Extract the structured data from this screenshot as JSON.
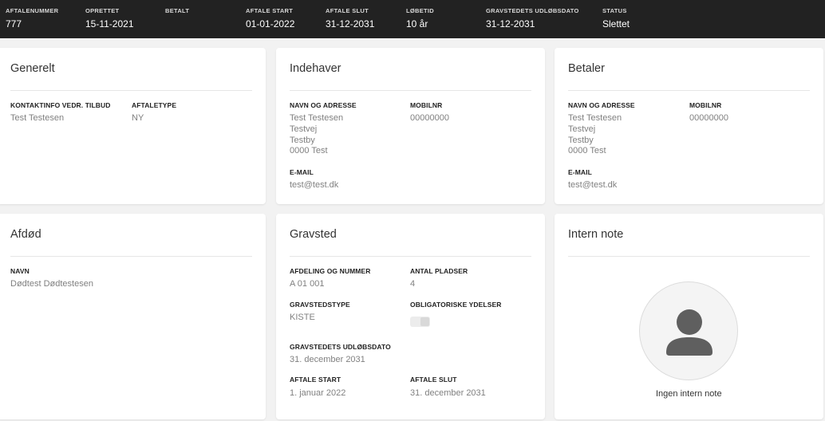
{
  "header": {
    "fields": [
      {
        "label": "AFTALENUMMER",
        "value": "777"
      },
      {
        "label": "OPRETTET",
        "value": "15-11-2021"
      },
      {
        "label": "BETALT",
        "value": ""
      },
      {
        "label": "AFTALE START",
        "value": "01-01-2022"
      },
      {
        "label": "AFTALE SLUT",
        "value": "31-12-2031"
      },
      {
        "label": "LØBETID",
        "value": "10 år"
      },
      {
        "label": "GRAVSTEDETS UDLØBSDATO",
        "value": "31-12-2031"
      },
      {
        "label": "STATUS",
        "value": "Slettet"
      }
    ]
  },
  "generelt": {
    "title": "Generelt",
    "contact_label": "KONTAKTINFO VEDR. TILBUD",
    "contact_value": "Test Testesen",
    "type_label": "AFTALETYPE",
    "type_value": "NY"
  },
  "indehaver": {
    "title": "Indehaver",
    "name_label": "NAVN OG ADRESSE",
    "name_lines": [
      "Test Testesen",
      "Testvej",
      "Testby",
      "0000 Test"
    ],
    "mobile_label": "MOBILNR",
    "mobile_value": "00000000",
    "email_label": "E-MAIL",
    "email_value": "test@test.dk"
  },
  "betaler": {
    "title": "Betaler",
    "name_label": "NAVN OG ADRESSE",
    "name_lines": [
      "Test Testesen",
      "Testvej",
      "Testby",
      "0000 Test"
    ],
    "mobile_label": "MOBILNR",
    "mobile_value": "00000000",
    "email_label": "E-MAIL",
    "email_value": "test@test.dk"
  },
  "afdod": {
    "title": "Afdød",
    "name_label": "NAVN",
    "name_value": "Dødtest Dødtestesen"
  },
  "gravsted": {
    "title": "Gravsted",
    "section_label": "AFDELING OG NUMMER",
    "section_value": "A 01 001",
    "places_label": "ANTAL PLADSER",
    "places_value": "4",
    "type_label": "GRAVSTEDSTYPE",
    "type_value": "KISTE",
    "mandatory_label": "OBLIGATORISKE YDELSER",
    "mandatory_on": false,
    "expiry_label": "GRAVSTEDETS UDLØBSDATO",
    "expiry_value": "31. december 2031",
    "start_label": "AFTALE START",
    "start_value": "1. januar 2022",
    "end_label": "AFTALE SLUT",
    "end_value": "31. december 2031"
  },
  "note": {
    "title": "Intern note",
    "avatar_icon": "person-icon",
    "empty_text": "Ingen intern note"
  },
  "colors": {
    "header_bg": "#222222",
    "page_bg": "#f2f2f2",
    "label": "#222222",
    "value": "#808080"
  }
}
